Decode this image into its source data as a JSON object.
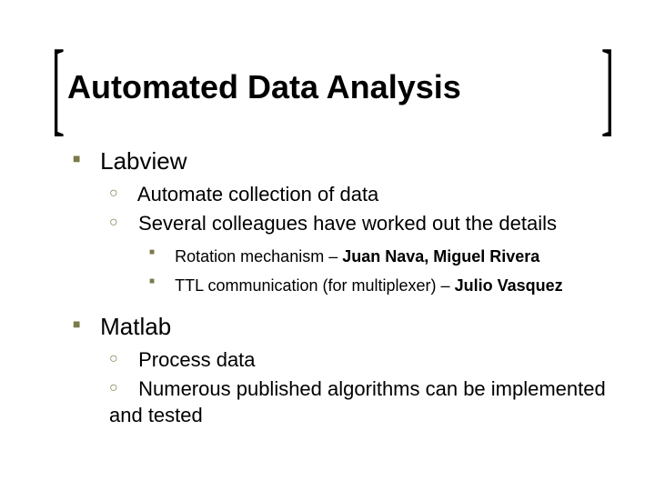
{
  "title": "Automated Data Analysis",
  "sections": [
    {
      "label": "Labview",
      "items": [
        {
          "text": "Automate collection of data"
        },
        {
          "text": "Several colleagues have worked out the details",
          "subitems": [
            {
              "prefix": "Rotation mechanism – ",
              "bold": "Juan Nava, Miguel Rivera"
            },
            {
              "prefix": "TTL communication (for multiplexer) – ",
              "bold": "Julio Vasquez"
            }
          ]
        }
      ]
    },
    {
      "label": "Matlab",
      "items": [
        {
          "text": "Process data"
        },
        {
          "text": "Numerous published algorithms can be implemented and tested"
        }
      ]
    }
  ]
}
